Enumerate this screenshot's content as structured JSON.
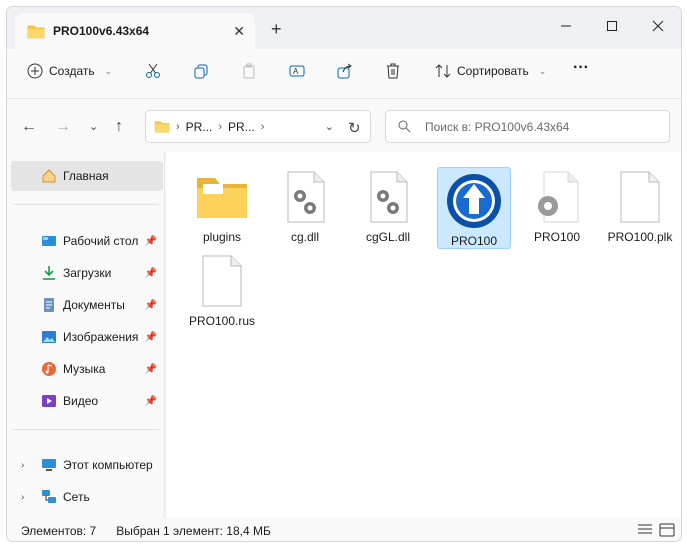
{
  "window": {
    "tab_title": "PRO100v6.43x64",
    "new_tab": "+",
    "close_tab": "✕"
  },
  "commands": {
    "create": "Создать",
    "sort": "Сортировать",
    "more": "···"
  },
  "address": {
    "crumbs": [
      "PR...",
      "PR..."
    ],
    "search_placeholder": "Поиск в: PRO100v6.43x64"
  },
  "sidebar": {
    "home": "Главная",
    "quick": [
      {
        "label": "Рабочий стол",
        "icon": "desktop-icon"
      },
      {
        "label": "Загрузки",
        "icon": "downloads-icon"
      },
      {
        "label": "Документы",
        "icon": "documents-icon"
      },
      {
        "label": "Изображения",
        "icon": "pictures-icon"
      },
      {
        "label": "Музыка",
        "icon": "music-icon"
      },
      {
        "label": "Видео",
        "icon": "video-icon"
      }
    ],
    "this_pc": "Этот компьютер",
    "network": "Сеть"
  },
  "files": [
    {
      "name": "plugins",
      "type": "folder"
    },
    {
      "name": "cg.dll",
      "type": "dll"
    },
    {
      "name": "cgGL.dll",
      "type": "dll"
    },
    {
      "name": "PRO100",
      "type": "app",
      "selected": true
    },
    {
      "name": "PRO100",
      "type": "config"
    },
    {
      "name": "PRO100.plk",
      "type": "blank"
    },
    {
      "name": "PRO100.rus",
      "type": "blank"
    }
  ],
  "status": {
    "items": "Элементов: 7",
    "selected": "Выбран 1 элемент: 18,4 МБ"
  },
  "colors": {
    "accent": "#0067c0",
    "folder": "#f8c94b",
    "selection": "#cce8ff"
  }
}
